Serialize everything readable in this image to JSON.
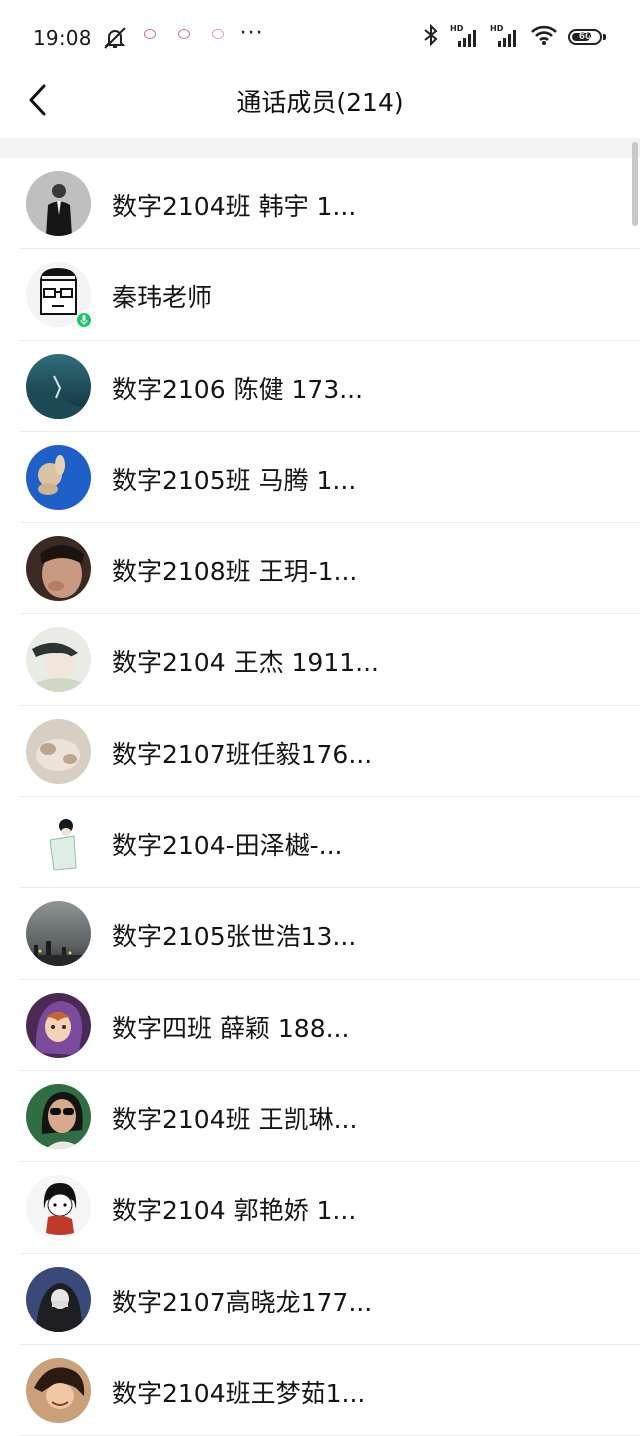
{
  "status_bar": {
    "time": "19:08",
    "more": "···",
    "network_tag_1": "HD",
    "network_tag_2": "HD",
    "battery": "60"
  },
  "nav": {
    "title": "通话成员(214)"
  },
  "members": [
    {
      "name": "数字2104班 韩宇 1...",
      "avatar": "person-suit"
    },
    {
      "name": "秦玮老师",
      "avatar": "pixel-glasses",
      "speaking": true
    },
    {
      "name": "数字2106 陈健 173...",
      "avatar": "underwater"
    },
    {
      "name": "数字2105班 马腾 1...",
      "avatar": "toy-blue"
    },
    {
      "name": "数字2108班 王玥-1...",
      "avatar": "face-closeup"
    },
    {
      "name": "数字2104 王杰 1911...",
      "avatar": "sketch-boy"
    },
    {
      "name": "数字2107班任毅176...",
      "avatar": "cat-beige"
    },
    {
      "name": "数字2104-田泽樾-...",
      "avatar": "anime-boy"
    },
    {
      "name": "数字2105张世浩13...",
      "avatar": "city-night"
    },
    {
      "name": "数字四班 薛颖 188...",
      "avatar": "cartoon-purple"
    },
    {
      "name": "数字2104班 王凯琳...",
      "avatar": "sunglasses-girl"
    },
    {
      "name": "数字2104 郭艳娇  1...",
      "avatar": "cartoon-girl"
    },
    {
      "name": "数字2107高晓龙177...",
      "avatar": "hooded-person"
    },
    {
      "name": "数字2104班王梦茹1...",
      "avatar": "smiling-girl"
    }
  ],
  "colors": {
    "speaking_badge": "#1ec46a",
    "divider": "#ececec",
    "band": "#f3f3f3"
  }
}
